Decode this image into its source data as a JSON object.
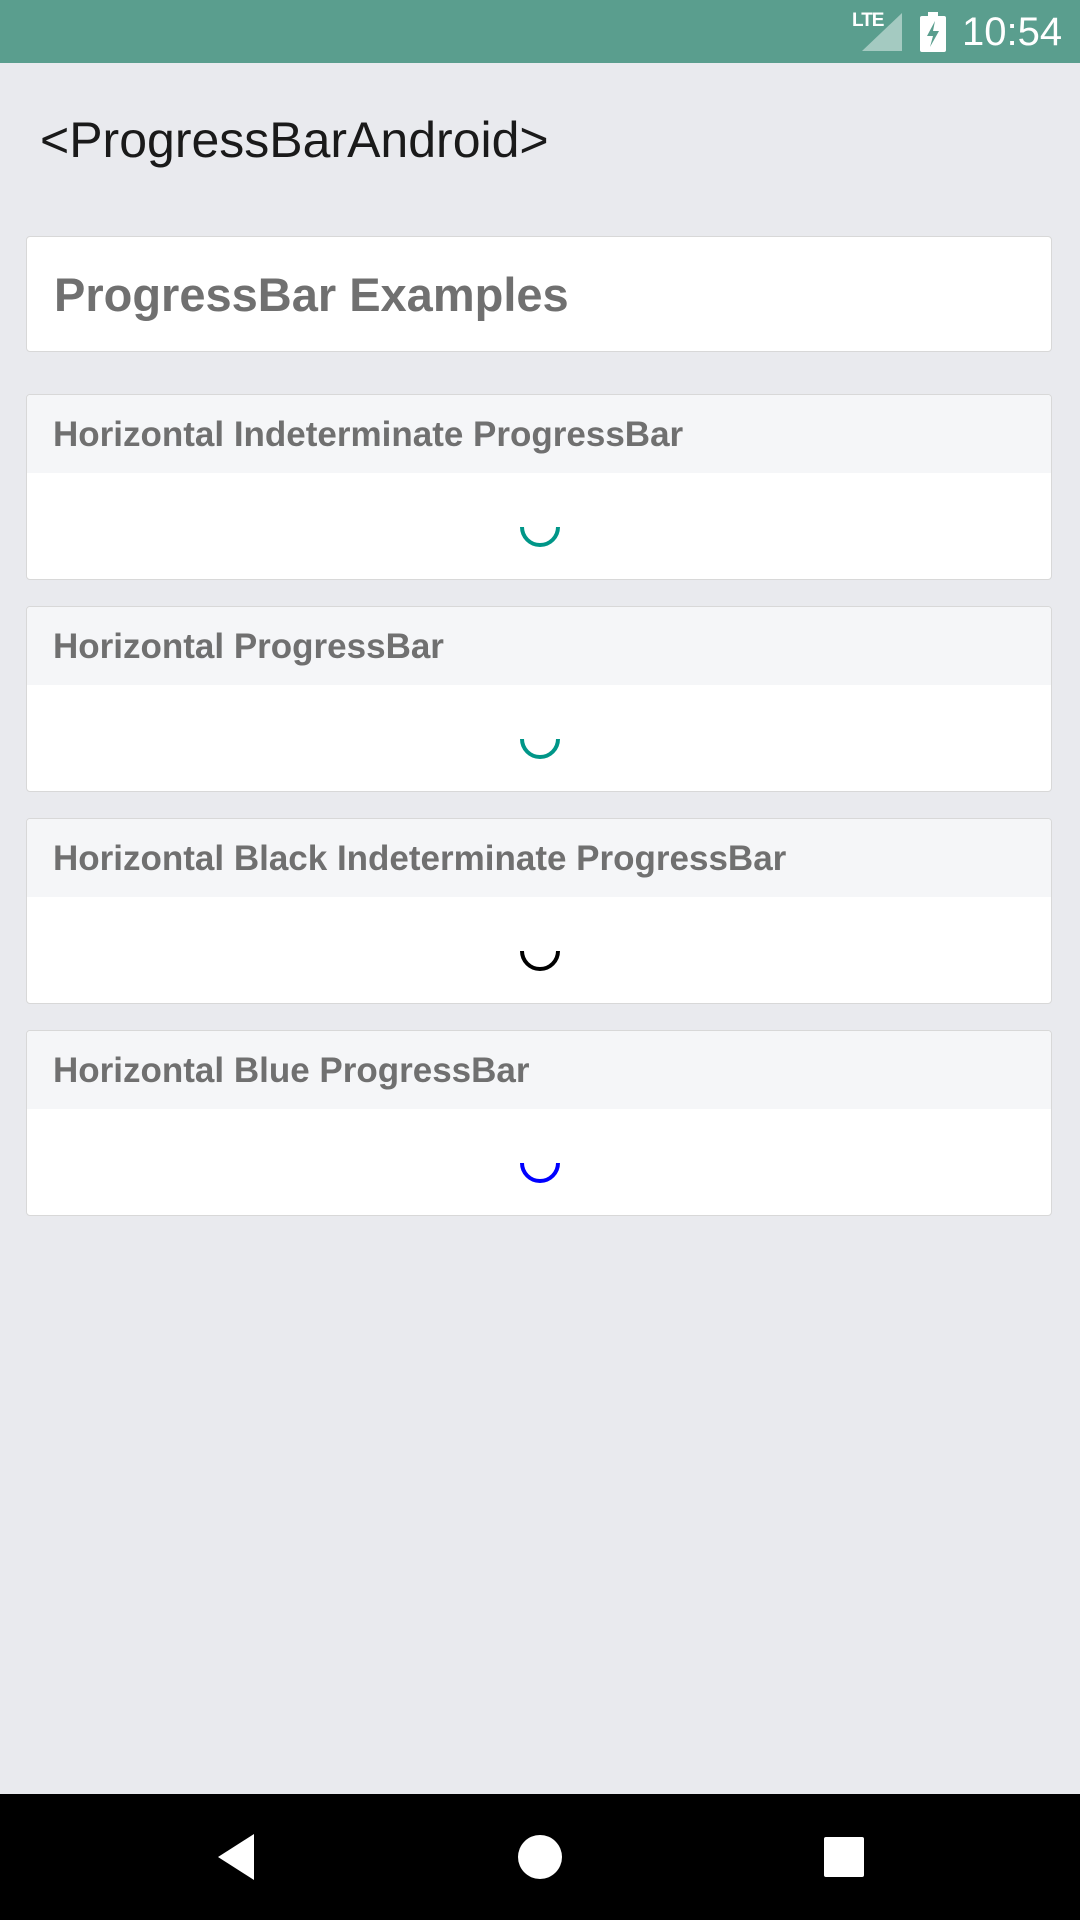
{
  "status_bar": {
    "network": "LTE",
    "time": "10:54",
    "background_color": "#5a9e8e"
  },
  "page": {
    "title": "<ProgressBarAndroid>"
  },
  "header_card": {
    "title": "ProgressBar Examples"
  },
  "examples": [
    {
      "title": "Horizontal Indeterminate ProgressBar",
      "spinner_color": "#009688"
    },
    {
      "title": "Horizontal ProgressBar",
      "spinner_color": "#009688"
    },
    {
      "title": "Horizontal Black Indeterminate ProgressBar",
      "spinner_color": "#000000"
    },
    {
      "title": "Horizontal Blue ProgressBar",
      "spinner_color": "#0000ff"
    }
  ],
  "nav_bar": {
    "icons": [
      "back-icon",
      "home-icon",
      "recents-icon"
    ]
  }
}
